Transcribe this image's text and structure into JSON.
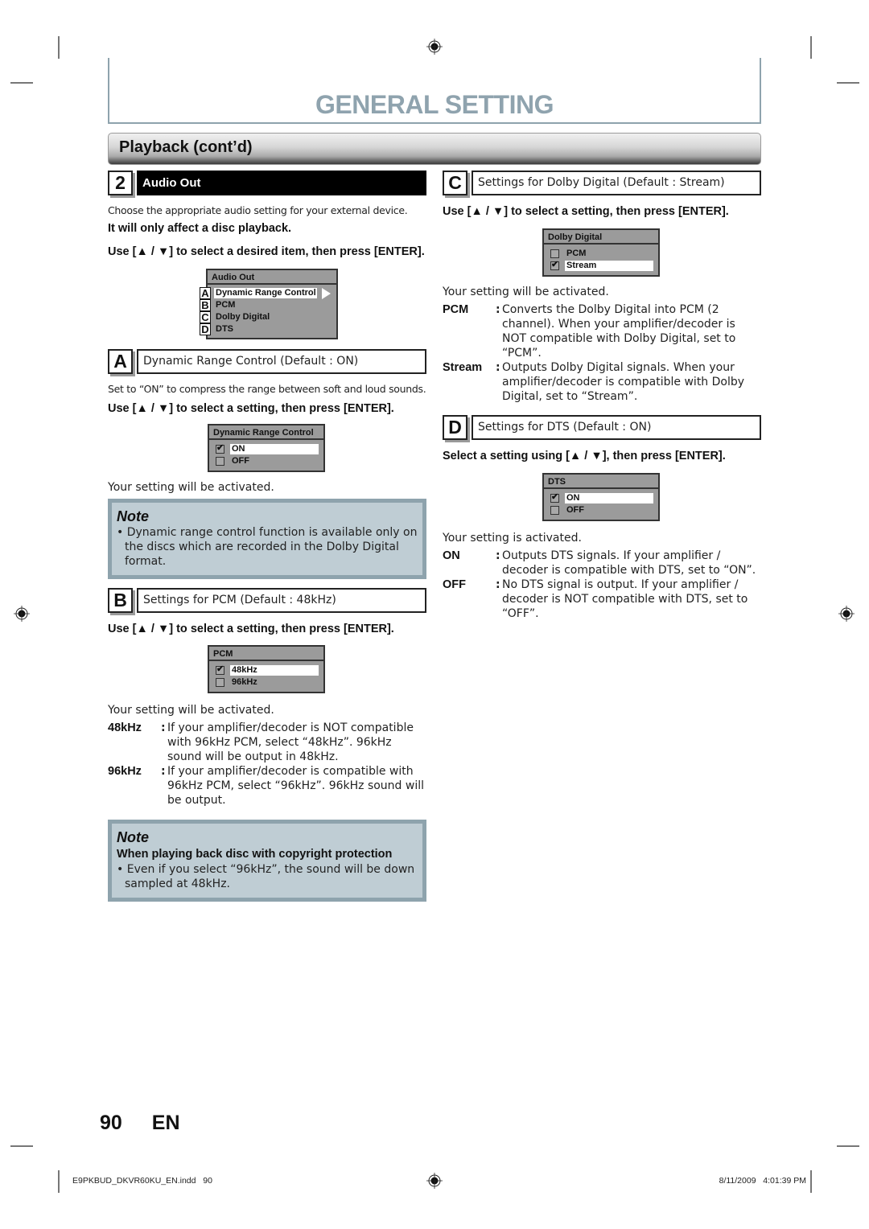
{
  "header": {
    "title": "GENERAL SETTING",
    "section": "Playback (cont’d)"
  },
  "step2": {
    "number": "2",
    "title": "Audio Out",
    "intro": "Choose the appropriate audio setting for your external device.",
    "bold_note": "It will only affect a disc playback.",
    "instruction": "Use [▲ / ▼] to select a desired item, then press [ENTER].",
    "menu": {
      "title": "Audio Out",
      "items": [
        {
          "letter": "A",
          "label": "Dynamic Range Control",
          "selected": true
        },
        {
          "letter": "B",
          "label": "PCM",
          "selected": false
        },
        {
          "letter": "C",
          "label": "Dolby Digital",
          "selected": false
        },
        {
          "letter": "D",
          "label": "DTS",
          "selected": false
        }
      ]
    }
  },
  "sectionA": {
    "letter": "A",
    "title": "Dynamic Range Control (Default : ON)",
    "desc": "Set to “ON” to compress the range between soft and loud sounds.",
    "instruction": "Use [▲ / ▼] to select a setting, then press [ENTER].",
    "menu": {
      "title": "Dynamic Range Control",
      "options": [
        {
          "label": "ON",
          "checked": true
        },
        {
          "label": "OFF",
          "checked": false
        }
      ]
    },
    "result": "Your setting will be activated.",
    "note": {
      "title": "Note",
      "bullet": "Dynamic range control function is available only on the discs which are recorded in the Dolby Digital format."
    }
  },
  "sectionB": {
    "letter": "B",
    "title": "Settings for PCM (Default : 48kHz)",
    "instruction": "Use [▲ / ▼] to select a setting, then press [ENTER].",
    "menu": {
      "title": "PCM",
      "options": [
        {
          "label": "48kHz",
          "checked": true
        },
        {
          "label": "96kHz",
          "checked": false
        }
      ]
    },
    "result": "Your setting will be activated.",
    "definitions": [
      {
        "term": "48kHz",
        "text": "If your amplifier/decoder is NOT compatible with 96kHz PCM, select “48kHz”. 96kHz sound will be output in 48kHz."
      },
      {
        "term": "96kHz",
        "text": "If your amplifier/decoder is compatible with 96kHz PCM, select “96kHz”. 96kHz sound will be output."
      }
    ],
    "note": {
      "title": "Note",
      "subtitle": "When playing back disc with copyright protection",
      "bullet": "Even if you select “96kHz”, the sound will be down sampled at 48kHz."
    }
  },
  "sectionC": {
    "letter": "C",
    "title": "Settings for Dolby Digital (Default : Stream)",
    "instruction": "Use [▲ / ▼] to select a setting, then press [ENTER].",
    "menu": {
      "title": "Dolby Digital",
      "options": [
        {
          "label": "PCM",
          "checked": false
        },
        {
          "label": "Stream",
          "checked": true
        }
      ]
    },
    "result": "Your setting will be activated.",
    "definitions": [
      {
        "term": "PCM",
        "text": "Converts the Dolby Digital into PCM (2 channel). When your amplifier/decoder is NOT compatible with Dolby Digital, set to “PCM”."
      },
      {
        "term": "Stream",
        "text": "Outputs Dolby Digital signals. When your amplifier/decoder is compatible with Dolby Digital, set to “Stream”."
      }
    ]
  },
  "sectionD": {
    "letter": "D",
    "title": "Settings for DTS (Default : ON)",
    "instruction": "Select a setting using [▲ / ▼], then press [ENTER].",
    "menu": {
      "title": "DTS",
      "options": [
        {
          "label": "ON",
          "checked": true
        },
        {
          "label": "OFF",
          "checked": false
        }
      ]
    },
    "result": "Your setting is activated.",
    "definitions": [
      {
        "term": "ON",
        "text": "Outputs DTS signals. If your amplifier / decoder is compatible with DTS, set to “ON”."
      },
      {
        "term": "OFF",
        "text": "No DTS signal is output. If your amplifier / decoder is NOT compatible with DTS, set to “OFF”."
      }
    ]
  },
  "page": {
    "number": "90",
    "lang": "EN"
  },
  "footer": {
    "file": "E9PKBUD_DKVR60KU_EN.indd   90",
    "timestamp": "8/11/2009   4:01:39 PM"
  },
  "colors": {
    "title_gray_blue": "#8fa3ae",
    "note_bg": "#bfcdd4",
    "note_border": "#8ea3ad",
    "osd_gray": "#9b9b9b"
  }
}
